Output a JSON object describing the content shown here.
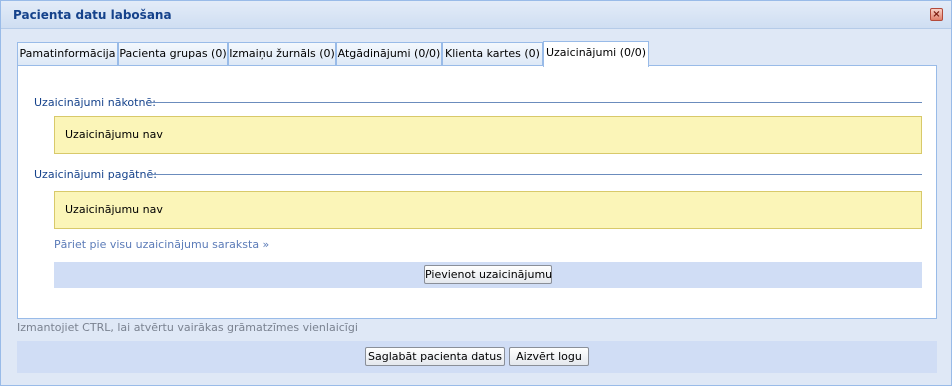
{
  "window": {
    "title": "Pacienta datu labošana",
    "close_label": "×"
  },
  "tabs": [
    {
      "label": "Pamatinformācija",
      "active": false
    },
    {
      "label": "Pacienta grupas (0)",
      "active": false
    },
    {
      "label": "Izmaiņu žurnāls (0)",
      "active": false
    },
    {
      "label": "Atgādinājumi (0/0)",
      "active": false
    },
    {
      "label": "Klienta kartes (0)",
      "active": false
    },
    {
      "label": "Uzaicinājumi (0/0)",
      "active": true
    }
  ],
  "invitations": {
    "future_legend": "Uzaicinājumi nākotnē:",
    "future_notice": "Uzaicinājumu nav",
    "past_legend": "Uzaicinājumi pagātnē:",
    "past_notice": "Uzaicinājumu nav",
    "all_link": "Pāriet pie visu uzaicinājumu saraksta »",
    "add_button": "Pievienot uzaicinājumu"
  },
  "hint": "Izmantojiet CTRL, lai atvērtu vairākas grāmatzīmes vienlaicīgi",
  "footer": {
    "save_button": "Saglabāt pacienta datus",
    "close_button": "Aizvērt logu"
  },
  "colors": {
    "accent": "#15428b",
    "notice_bg": "#fbf5b8",
    "panel_border": "#99bbe8"
  }
}
